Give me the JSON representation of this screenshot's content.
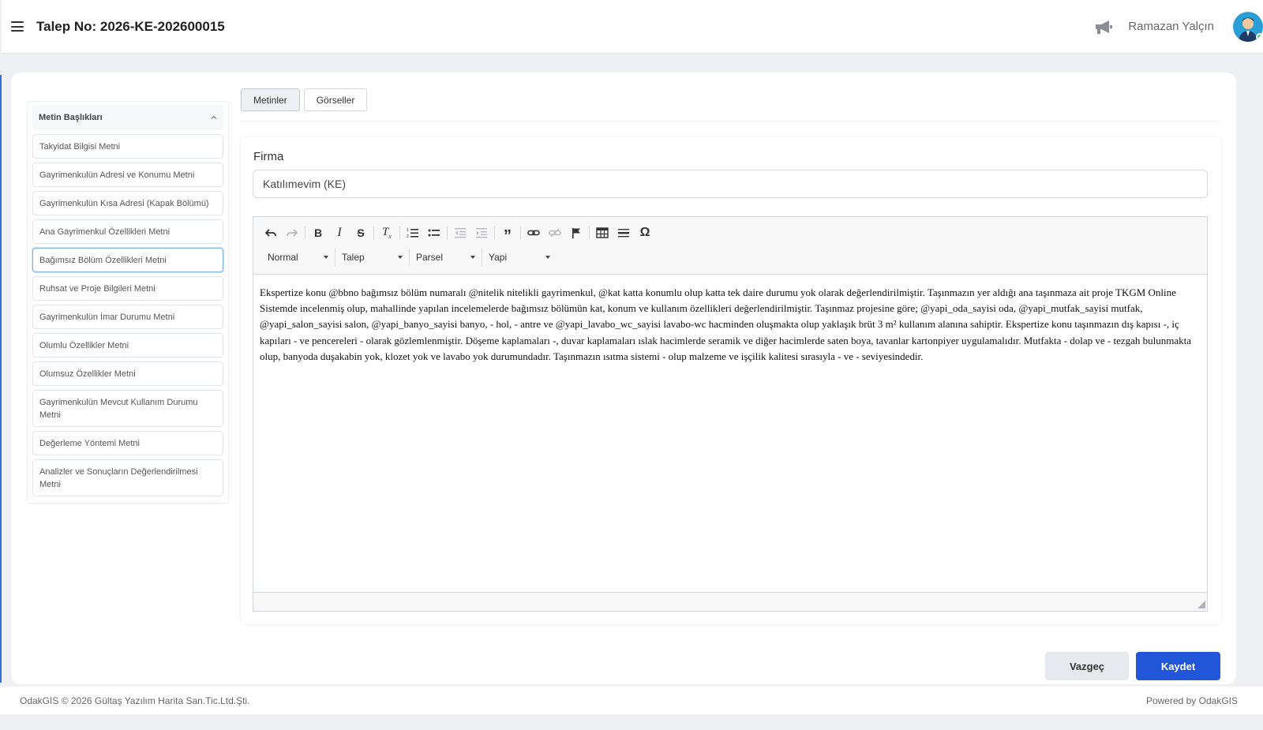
{
  "header": {
    "title": "Talep No: 2026-KE-202600015",
    "user_name": "Ramazan Yalçın"
  },
  "sidebar": {
    "title": "Metin Başlıkları",
    "items": [
      {
        "label": "Takyidat Bilgisi Metni"
      },
      {
        "label": "Gayrimenkulün Adresi ve Konumu Metni"
      },
      {
        "label": "Gayrimenkulün Kısa Adresi (Kapak Bölümü)"
      },
      {
        "label": "Ana Gayrimenkul Özellikleri Metni"
      },
      {
        "label": "Bağımsız Bölüm Özellikleri Metni",
        "active": true
      },
      {
        "label": "Ruhsat ve Proje Bilgileri Metni"
      },
      {
        "label": "Gayrimenkulün İmar Durumu Metni"
      },
      {
        "label": "Olumlu Özellikler Metni"
      },
      {
        "label": "Olumsuz Özellikler Metni"
      },
      {
        "label": "Gayrimenkulün Mevcut Kullanım Durumu Metni"
      },
      {
        "label": "Değerleme Yöntemi Metni"
      },
      {
        "label": "Analizler ve Sonuçların Değerlendirilmesi Metni"
      }
    ]
  },
  "tabs": [
    {
      "label": "Metinler",
      "active": true
    },
    {
      "label": "Görseller",
      "active": false
    }
  ],
  "form": {
    "firma_label": "Firma",
    "firma_value": "Katılımevim (KE)"
  },
  "editor": {
    "format_options": [
      "Normal",
      "Talep",
      "Parsel",
      "Yapi"
    ],
    "content": "Ekspertize konu @bbno bağımsız bölüm numaralı @nitelik nitelikli gayrimenkul, @kat katta konumlu olup katta tek daire durumu yok olarak değerlendirilmiştir. Taşınmazın yer aldığı ana taşınmaza ait proje TKGM Online Sistemde incelenmiş olup, mahallinde yapılan incelemelerde bağımsız bölümün kat, konum ve kullanım özellikleri değerlendirilmiştir. Taşınmaz projesine göre; @yapi_oda_sayisi oda, @yapi_mutfak_sayisi mutfak, @yapi_salon_sayisi salon, @yapi_banyo_sayisi banyo, - hol, - antre ve @yapi_lavabo_wc_sayisi lavabo-wc hacminden oluşmakta olup yaklaşık brüt 3 m² kullanım alanına sahiptir. Ekspertize konu taşınmazın dış kapısı -, iç kapıları - ve pencereleri - olarak gözlemlenmiştir. Döşeme kaplamaları -, duvar kaplamaları ıslak hacimlerde seramik ve diğer hacimlerde saten boya, tavanlar kartonpiyer uygulamalıdır. Mutfakta - dolap ve - tezgah bulunmakta olup, banyoda duşakabin yok, klozet yok ve lavabo yok durumundadır. Taşınmazın ısıtma sistemi - olup malzeme ve işçilik kalitesi sırasıyla - ve - seviyesindedir."
  },
  "actions": {
    "cancel_label": "Vazgeç",
    "save_label": "Kaydet"
  },
  "footer": {
    "copyright": "OdakGIS © 2026 Gültaş Yazılım Harita San.Tic.Ltd.Şti.",
    "powered_by": "Powered by OdakGIS"
  },
  "colors": {
    "primary": "#2156d9",
    "accent_strip": "#2f6fd6",
    "avatar_bg": "#2a9fd6",
    "online": "#3cc36b"
  }
}
